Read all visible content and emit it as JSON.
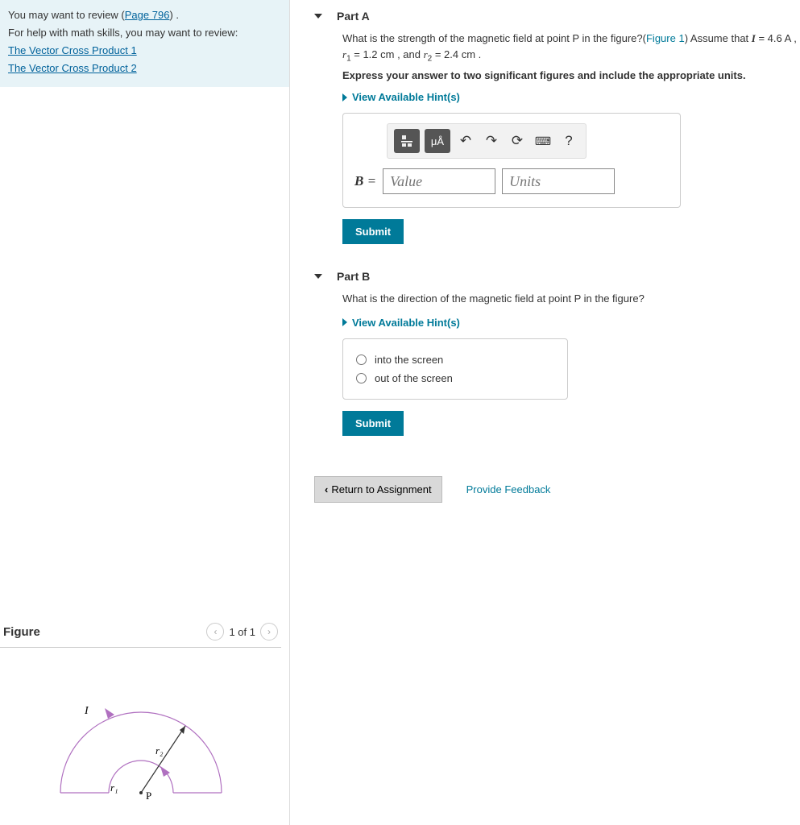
{
  "review": {
    "intro_prefix": "You may want to review (",
    "page_link": "Page 796",
    "intro_suffix": ") .",
    "help_text": "For help with math skills, you may want to review:",
    "links": [
      "The Vector Cross Product 1",
      "The Vector Cross Product 2"
    ]
  },
  "partA": {
    "label": "Part A",
    "q_prefix": "What is the strength of the magnetic field at point P in the figure?(",
    "fig_link": "Figure 1",
    "q_mid": ") Assume that ",
    "I_sym": "I",
    "I_eq": " = 4.6 A ,",
    "line2_prefix": "r",
    "r1_sub": "1",
    "r1_val": " = 1.2 cm , and ",
    "r2_sym": "r",
    "r2_sub": "2",
    "r2_val": " = 2.4 cm .",
    "instruct": "Express your answer to two significant figures and include the appropriate units.",
    "hints": "View Available Hint(s)",
    "toolbar": {
      "units_btn": "μÅ",
      "help": "?"
    },
    "eq_label": "B = ",
    "value_ph": "Value",
    "units_ph": "Units",
    "submit": "Submit"
  },
  "partB": {
    "label": "Part B",
    "question": "What is the direction of the magnetic field at point P in the figure?",
    "hints": "View Available Hint(s)",
    "options": [
      "into the screen",
      "out of the screen"
    ],
    "submit": "Submit"
  },
  "bottom": {
    "return": "Return to Assignment",
    "feedback": "Provide Feedback"
  },
  "figure": {
    "title": "Figure",
    "pager": "1 of 1",
    "I_label": "I",
    "r1_label": "r₁",
    "r2_label": "r₂",
    "P_label": "P"
  }
}
